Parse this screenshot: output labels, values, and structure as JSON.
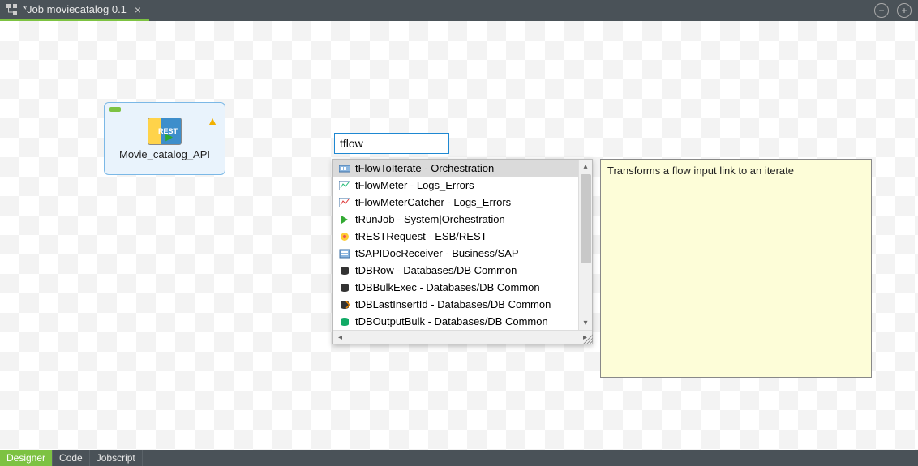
{
  "tab": {
    "title": "*Job moviecatalog 0.1"
  },
  "node": {
    "label": "Movie_catalog_API",
    "badge": "REST"
  },
  "search": {
    "value": "tflow"
  },
  "dropdown": {
    "items": [
      {
        "label": "tFlowToIterate - Orchestration"
      },
      {
        "label": "tFlowMeter - Logs_Errors"
      },
      {
        "label": "tFlowMeterCatcher - Logs_Errors"
      },
      {
        "label": "tRunJob - System|Orchestration"
      },
      {
        "label": "tRESTRequest - ESB/REST"
      },
      {
        "label": "tSAPIDocReceiver - Business/SAP"
      },
      {
        "label": "tDBRow - Databases/DB Common"
      },
      {
        "label": "tDBBulkExec - Databases/DB Common"
      },
      {
        "label": "tDBLastInsertId - Databases/DB Common"
      },
      {
        "label": "tDBOutputBulk - Databases/DB Common"
      }
    ]
  },
  "tooltip": {
    "text": "Transforms a flow input link to an iterate"
  },
  "bottom_tabs": {
    "designer": "Designer",
    "code": "Code",
    "jobscript": "Jobscript"
  }
}
